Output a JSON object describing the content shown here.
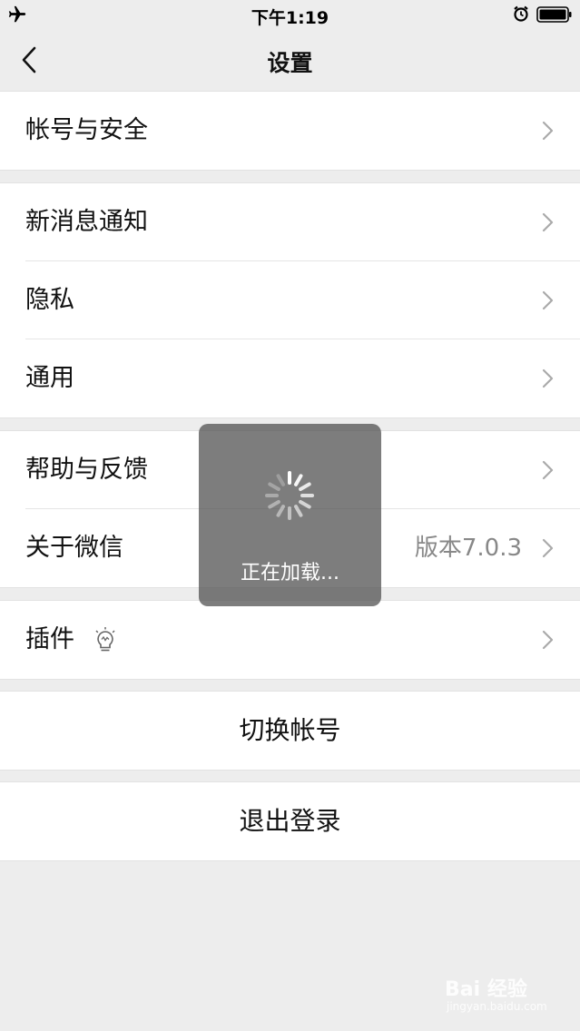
{
  "status_bar": {
    "time": "下午1:19"
  },
  "nav": {
    "title": "设置"
  },
  "groups": {
    "account": {
      "label": "帐号与安全"
    },
    "notifications": {
      "label": "新消息通知"
    },
    "privacy": {
      "label": "隐私"
    },
    "general": {
      "label": "通用"
    },
    "help": {
      "label": "帮助与反馈"
    },
    "about": {
      "label": "关于微信",
      "value": "版本7.0.3"
    },
    "plugins": {
      "label": "插件"
    },
    "switch_account": {
      "label": "切换帐号"
    },
    "logout": {
      "label": "退出登录"
    }
  },
  "toast": {
    "text": "正在加载..."
  },
  "watermark": {
    "brand": "Bai 经验",
    "url": "jingyan.baidu.com"
  },
  "icons": {
    "back": "chevron-left-icon",
    "row_arrow": "chevron-right-icon",
    "plugin": "lightbulb-icon",
    "status_left": "airplane-icon",
    "status_right": [
      "alarm-icon",
      "battery-icon"
    ]
  }
}
